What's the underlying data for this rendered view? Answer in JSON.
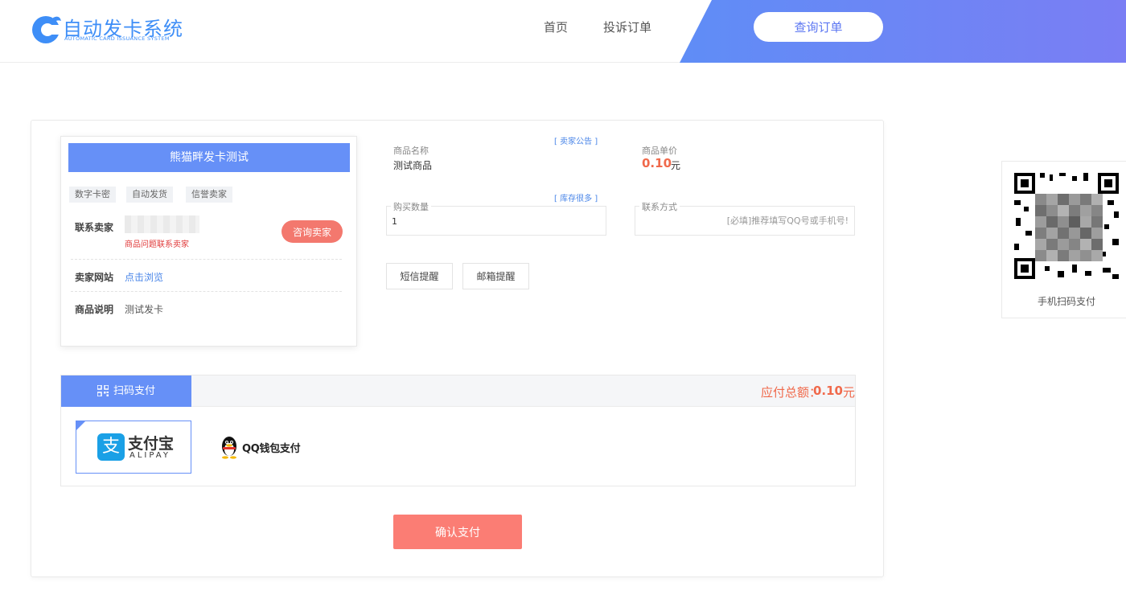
{
  "header": {
    "logo_title": "自动发卡系统",
    "logo_subtitle": "AUTOMATIC CARD ISSUANCE SYSTEM",
    "nav": {
      "home": "首页",
      "complaint": "投诉订单"
    },
    "query_button": "查询订单",
    "colors": {
      "brand": "#3e8ef7",
      "gradient_start": "#5f8df6",
      "gradient_end": "#7a7ef4"
    }
  },
  "seller": {
    "shop_name": "熊猫畔发卡测试",
    "tags": [
      "数字卡密",
      "自动发货",
      "信誉卖家"
    ],
    "contact_label": "联系卖家",
    "contact_note": "商品问题联系卖家",
    "ask_button": "咨询卖家",
    "site_label": "卖家网站",
    "site_link": "点击浏览",
    "desc_label": "商品说明",
    "desc_value": "测试发卡"
  },
  "goods": {
    "name_label": "商品名称",
    "name_value": "测试商品",
    "notice_link": "[ 卖家公告 ]",
    "price_label": "商品单价",
    "price_value": "0.10",
    "price_unit": "元",
    "qty_label": "购买数量",
    "qty_value": "1",
    "stock_link": "[ 库存很多 ]",
    "contact_label": "联系方式",
    "contact_placeholder": "[必填]推荐填写QQ号或手机号!",
    "sms_button": "短信提醒",
    "email_button": "邮箱提醒"
  },
  "payment": {
    "tab_label": "扫码支付",
    "total_label": "应付总额：",
    "total_value": "0.10",
    "total_unit": "元",
    "alipay_name": "支付宝",
    "alipay_en": "ALIPAY",
    "alipay_glyph": "支",
    "qq_name": "QQ钱包支付",
    "confirm_button": "确认支付",
    "colors": {
      "accent": "#6690f7",
      "price": "#f0694b",
      "confirm": "#fb7d74"
    }
  },
  "qr": {
    "caption": "手机扫码支付"
  }
}
